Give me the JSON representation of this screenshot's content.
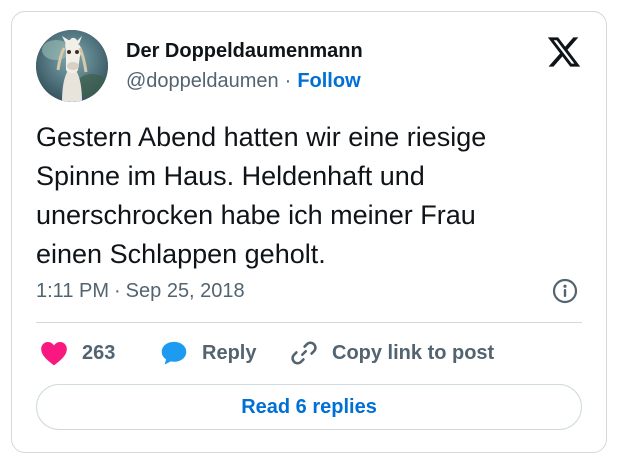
{
  "author": {
    "name": "Der Doppeldaumenmann",
    "handle": "@doppeldaumen",
    "separator": "·",
    "follow_label": "Follow"
  },
  "tweet": {
    "lines": [
      "Gestern Abend hatten wir eine riesige",
      "Spinne im Haus. Heldenhaft und",
      "unerschrocken habe ich meiner Frau",
      "einen Schlappen geholt."
    ],
    "time": "1:11 PM",
    "separator": "·",
    "date": "Sep 25, 2018"
  },
  "actions": {
    "like_count": "263",
    "reply_label": "Reply",
    "copy_link_label": "Copy link to post"
  },
  "read_replies_label": "Read 6 replies",
  "icons": {
    "brand": "x-logo-icon",
    "info": "info-icon",
    "like": "heart-icon",
    "reply": "speech-bubble-icon",
    "copy": "link-icon"
  },
  "colors": {
    "link": "#006fd6",
    "like": "#f91880",
    "reply": "#1d9bf0",
    "text": "#0f1419",
    "muted": "#536471",
    "border": "#cfd9de"
  }
}
